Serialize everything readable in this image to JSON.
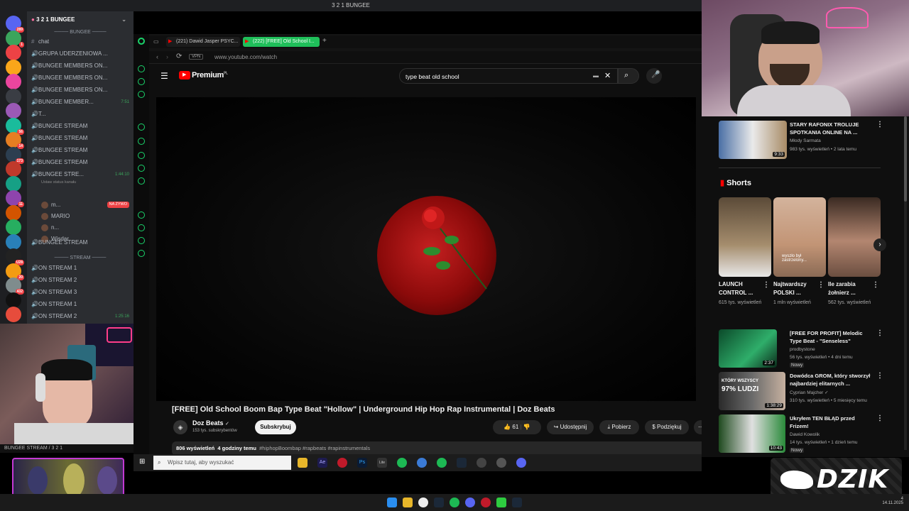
{
  "window": {
    "title": "3 2 1 BUNGEE"
  },
  "discord": {
    "server_name": "3 2 1 BUNGEE",
    "server_badges": [
      "289",
      "1",
      "",
      "",
      "",
      "",
      "",
      "56",
      "14",
      "173",
      "",
      "",
      "11",
      "",
      "",
      "",
      "U28",
      "20",
      "432",
      "",
      ""
    ],
    "categories": {
      "bungee": "BUNGEE",
      "stream": "STREAM"
    },
    "channels": [
      {
        "label": "chat",
        "time": ""
      },
      {
        "label": "GRUPA UDERZENIOWA ...",
        "time": ""
      },
      {
        "label": "BUNGEE MEMBERS ON...",
        "time": ""
      },
      {
        "label": "BUNGEE MEMBERS ON...",
        "time": ""
      },
      {
        "label": "BUNGEE MEMBERS ON...",
        "time": ""
      },
      {
        "label": "BUNGEE MEMBER...",
        "time": "7:51"
      },
      {
        "label": "T...",
        "time": ""
      },
      {
        "label": "BUNGEE STREAM",
        "time": ""
      },
      {
        "label": "BUNGEE STREAM",
        "time": ""
      },
      {
        "label": "BUNGEE STREAM",
        "time": ""
      },
      {
        "label": "BUNGEE STREAM",
        "time": ""
      },
      {
        "label": "BUNGEE STRE...",
        "time": "1:44:10"
      }
    ],
    "status_hint": "Ustaw status kanału",
    "voice_users": [
      {
        "name": "m...",
        "badge": "NA ŻYWO"
      },
      {
        "name": "MARIO",
        "badge": ""
      },
      {
        "name": "n...",
        "badge": ""
      },
      {
        "name": "Wisdar",
        "badge": ""
      }
    ],
    "channels2": [
      {
        "label": "BUNGEE STREAM",
        "time": ""
      },
      {
        "label": "ON STREAM 1",
        "time": ""
      },
      {
        "label": "ON STREAM 2",
        "time": ""
      },
      {
        "label": "ON STREAM 3",
        "time": ""
      },
      {
        "label": "ON STREAM 1",
        "time": ""
      },
      {
        "label": "ON STREAM 2",
        "time": "1:25:16"
      }
    ],
    "cam_footer": "BUNGEE STREAM / 3 2 1"
  },
  "browser": {
    "tabs": [
      {
        "label": "(221) Dawid Jasper PSYC..."
      },
      {
        "label": "(222) [FREE] Old School I..."
      }
    ],
    "vpn": "VPN",
    "url": "www.youtube.com/watch"
  },
  "youtube": {
    "brand": "Premium",
    "brand_suffix": "PL",
    "search_value": "type beat old school",
    "video_title": "[FREE] Old School Boom Bap Type Beat \"Hollow\" | Underground Hip Hop Rap Instrumental | Doz Beats",
    "channel_name": "Doz Beats",
    "subscribers": "153 tys. subskrybentów",
    "subscribe_label": "Subskrybuj",
    "likes": "61",
    "share_label": "Udostępnij",
    "download_label": "Pobierz",
    "thanks_label": "Podziękuj",
    "views": "806 wyświetleń",
    "published": "4 godziny temu",
    "hashtags": "#hiphopBoombap #rapbeats #rapinstrumentals",
    "shorts_label": "Shorts",
    "recommended_top": {
      "title": "STARY RAFONIX TROLUJE SPOTKANIA ONLINE NA ...",
      "channel": "Młody Sarmata",
      "meta": "983 tys. wyświetleń • 2 lata temu",
      "duration": "9:33"
    },
    "shorts": [
      {
        "title": "LAUNCH CONTROL ...",
        "views": "615 tys. wyświetleń",
        "overlay": ""
      },
      {
        "title": "Najtwardszy POLSKI ...",
        "views": "1 mln wyświetleń",
        "overlay": "wyszło był zastrzelony..."
      },
      {
        "title": "Ile zarabia żołnierz ...",
        "views": "562 tys. wyświetleń",
        "overlay": ""
      }
    ],
    "recommended": [
      {
        "title": "[FREE FOR PROFIT] Melodic Type Beat - \"Senseless\"",
        "channel": "prodbystone",
        "meta": "56 tys. wyświetleń • 4 dni temu",
        "badge": "Nowy",
        "duration": "2:37"
      },
      {
        "title": "Dowódca GROM, który stworzył najbardziej elitarnych ...",
        "channel": "Cyprian Majcher",
        "meta": "310 tys. wyświetleń • 5 miesięcy temu",
        "badge": "",
        "duration": "1:38:29",
        "thumb_text": "KTÓRY WSZYSCY",
        "thumb_text2": "97% LUDZI"
      },
      {
        "title": "Ukryłem TEN BŁĄD przed Frizem!",
        "channel": "Dawid Kowolik",
        "meta": "14 tys. wyświetleń • 1 dzień temu",
        "badge": "Nowy",
        "duration": "10:43"
      }
    ]
  },
  "taskbar": {
    "search_placeholder": "Wpisz tutaj, aby wyszukać",
    "date": "14.11.2025",
    "time": "4"
  },
  "overlay": {
    "brand": "DZIK"
  },
  "colors": {
    "discord_bg": "#2b2d31",
    "yt_red": "#ff0000",
    "opera_green": "#1ad36a",
    "moon": "#c42020"
  }
}
